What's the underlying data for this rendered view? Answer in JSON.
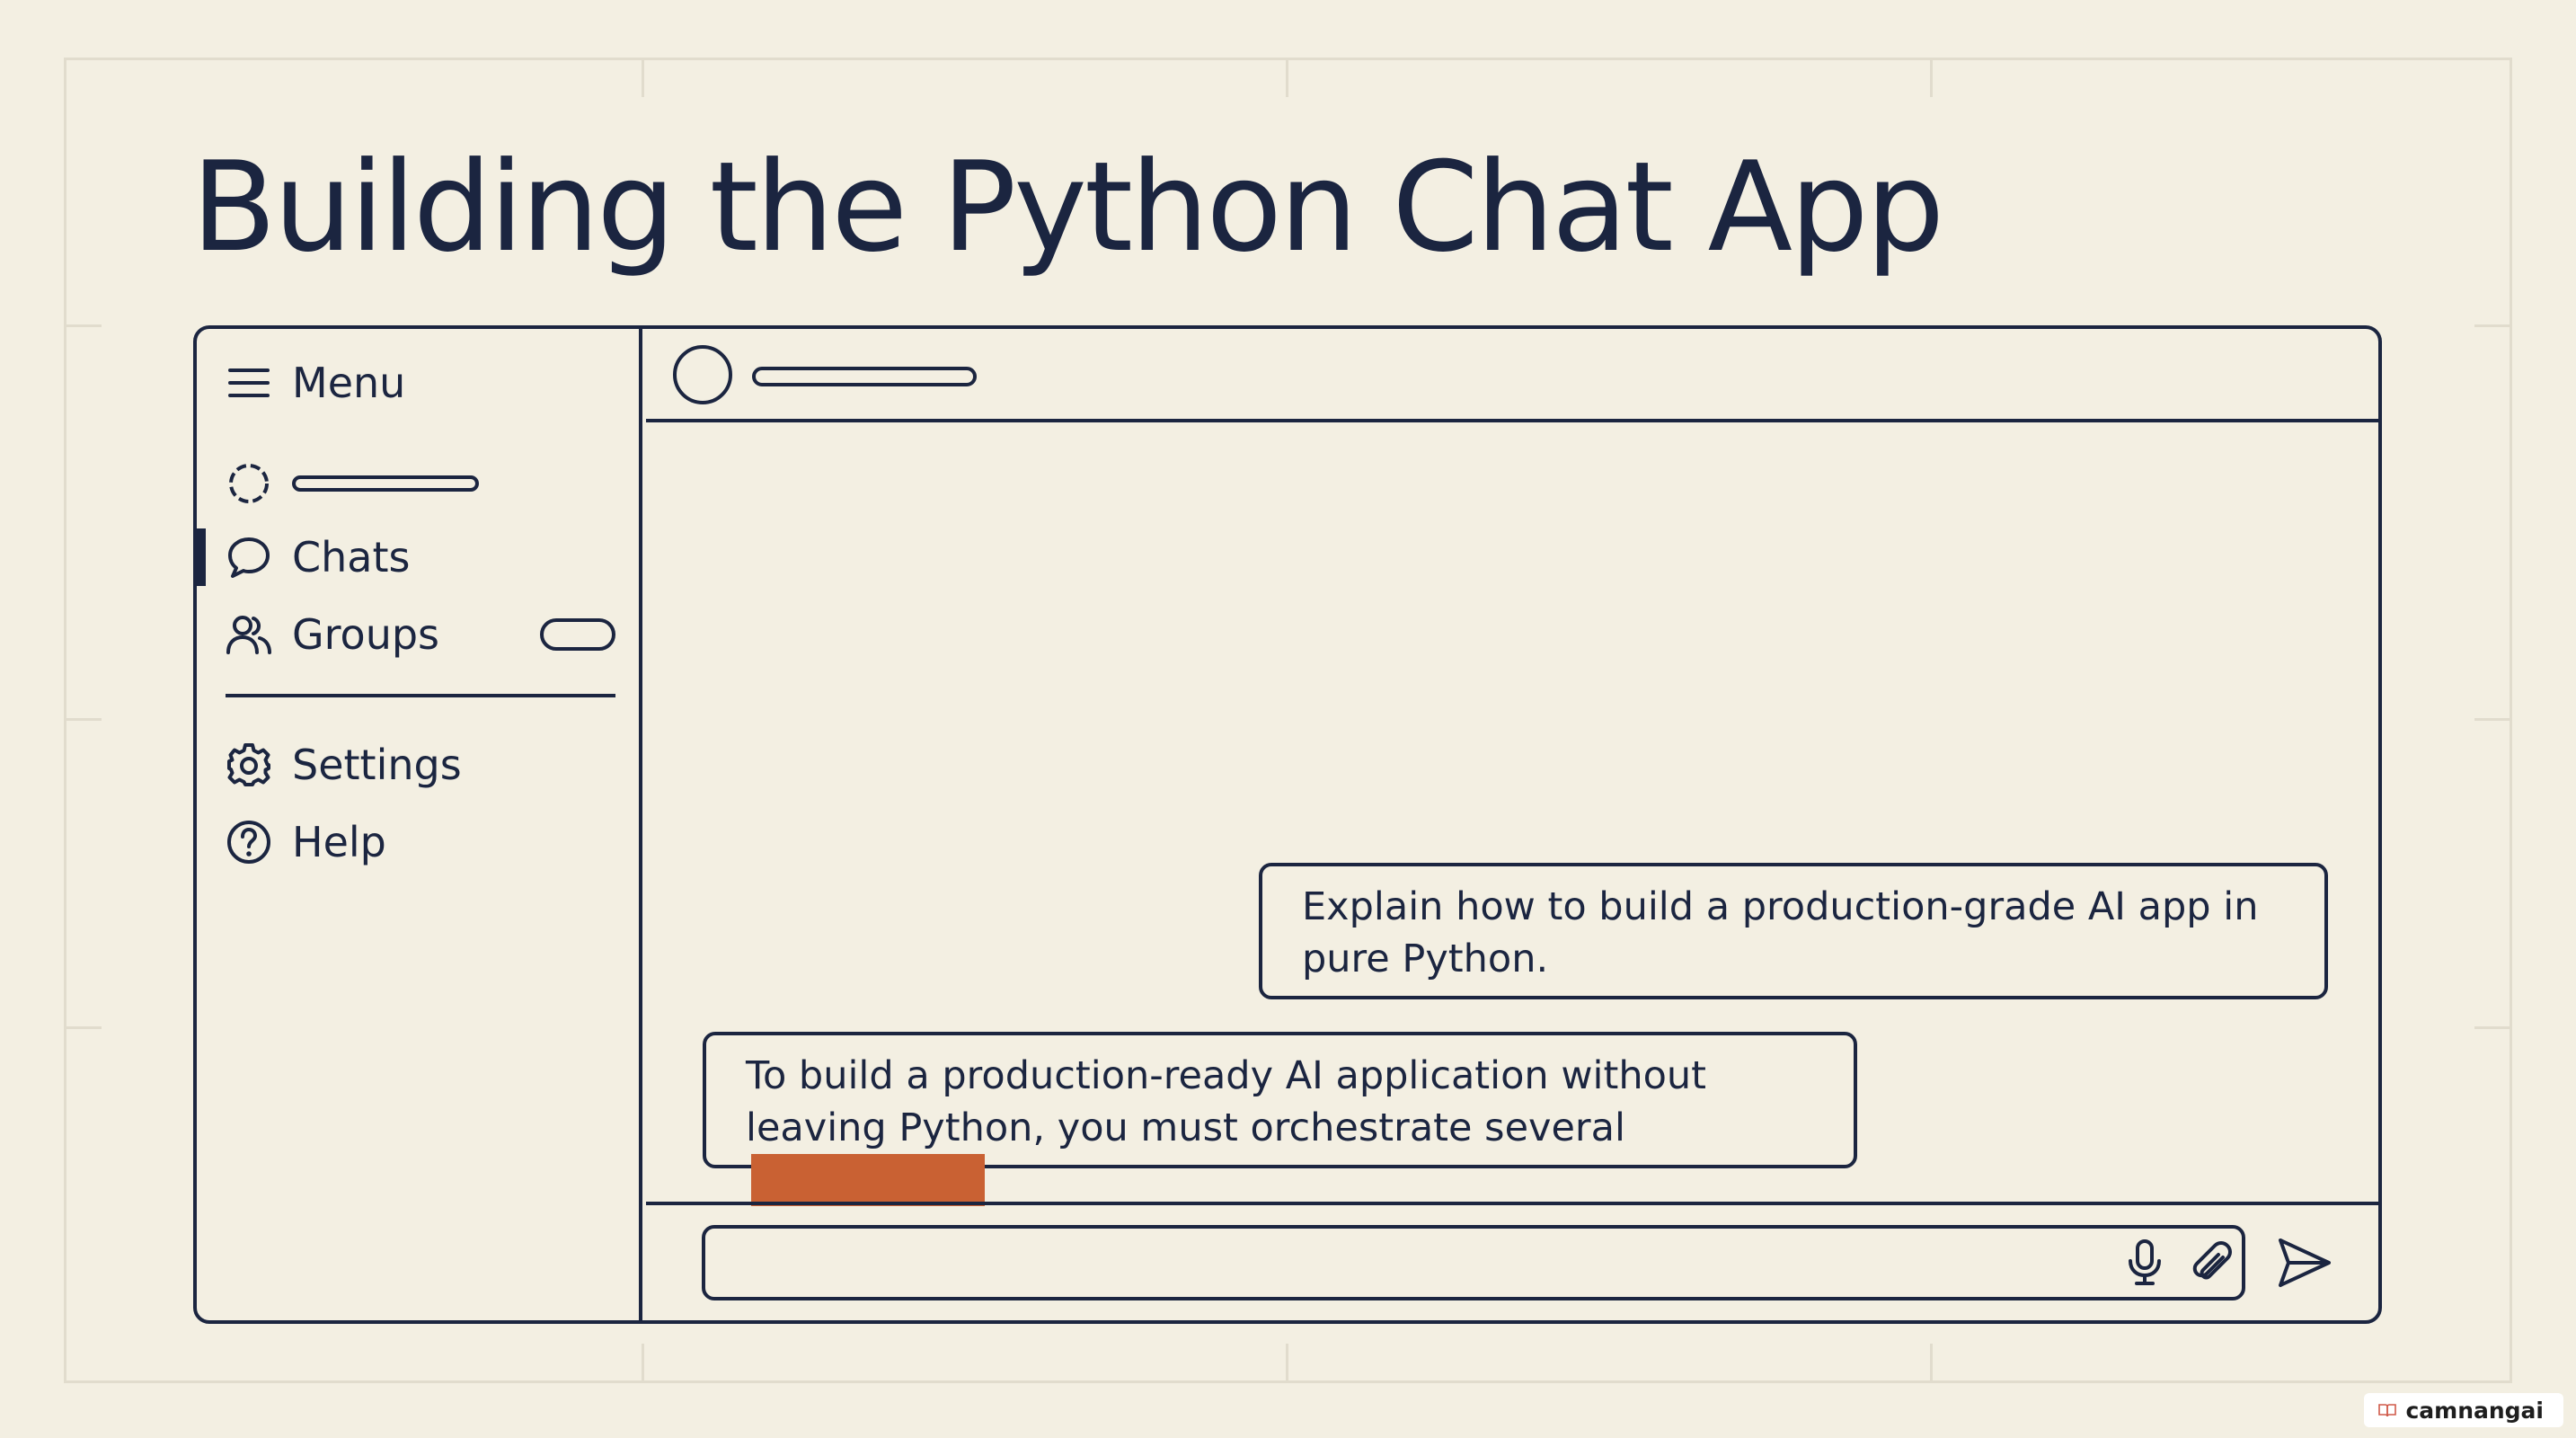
{
  "slide": {
    "title": "Building the Python Chat App"
  },
  "sidebar": {
    "menu": {
      "label": "Menu",
      "icon": "hamburger-menu-icon"
    },
    "items": [
      {
        "label": "",
        "icon": "loading-spinner-icon"
      },
      {
        "label": "Chats",
        "icon": "speech-bubble-icon",
        "active": true
      },
      {
        "label": "Groups",
        "icon": "users-icon"
      },
      {
        "label": "Settings",
        "icon": "gear-icon"
      },
      {
        "label": "Help",
        "icon": "question-circle-icon"
      }
    ]
  },
  "chat": {
    "messages": [
      {
        "role": "user",
        "text": "Explain how to build a production-grade AI app in pure Python."
      },
      {
        "role": "assistant",
        "text": "To build a production-ready AI application without leaving Python, you must orchestrate several",
        "highlight_color": "#c96133"
      }
    ]
  },
  "composer": {
    "placeholder": "",
    "icons": [
      "microphone-icon",
      "paperclip-icon",
      "send-icon"
    ]
  },
  "watermark": {
    "text": "camnangai"
  },
  "colors": {
    "background": "#f3efe2",
    "ink": "#1b2540",
    "accent": "#c96133"
  }
}
